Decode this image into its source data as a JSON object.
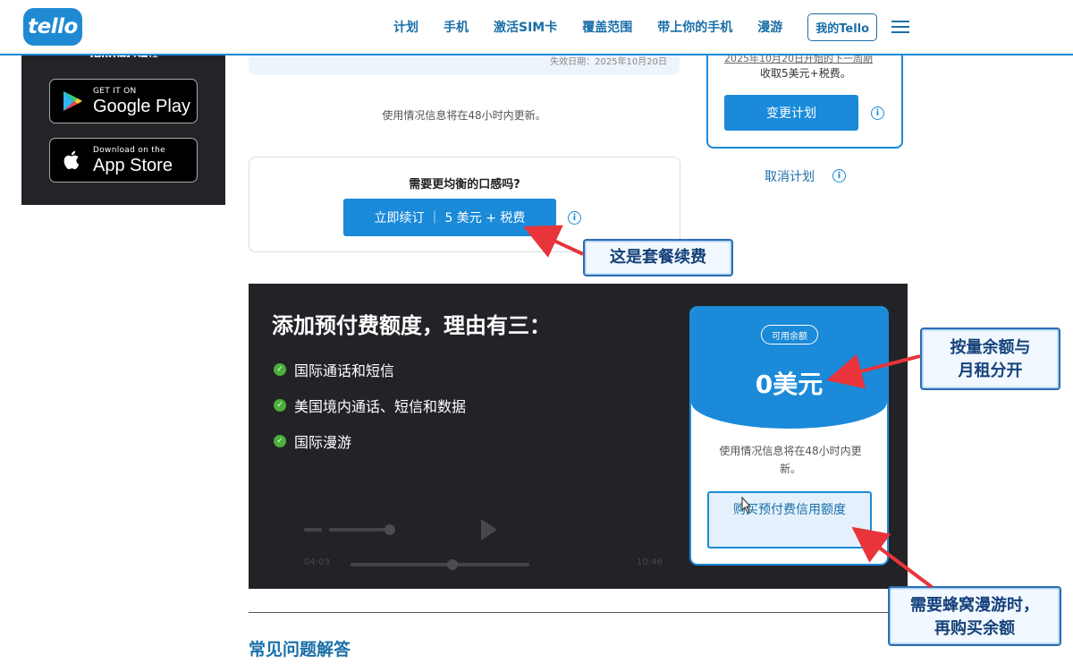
{
  "header": {
    "logo": "tello",
    "nav": [
      "计划",
      "手机",
      "激活SIM卡",
      "覆盖范围",
      "带上你的手机",
      "漫游"
    ],
    "my_tello": "我的Tello",
    "menu_icon": "hamburger-icon"
  },
  "app_panel": {
    "title": "Tello进行通话",
    "google_play": {
      "small": "GET IT ON",
      "big": "Google Play"
    },
    "app_store": {
      "small": "Download on the",
      "big": "App Store"
    }
  },
  "plan_status": {
    "date_text": "失效日期：2025年10月20日",
    "usage_note": "使用情况信息将在48小时内更新。"
  },
  "renew": {
    "question": "需要更均衡的口感吗?",
    "button": "立即续订 ｜ 5 美元 + 税费"
  },
  "plan_box": {
    "date_line": "2025年10月20日开始的下一周期",
    "fee_line": "收取5美元+税费。",
    "change_button": "变更计划",
    "cancel_link": "取消计划"
  },
  "prepaid": {
    "title": "添加预付费额度，理由有三：",
    "reasons": [
      "国际通话和短信",
      "美国境内通话、短信和数据",
      "国际漫游"
    ],
    "video": {
      "time_current": "04:03",
      "time_total": "10:46"
    }
  },
  "balance": {
    "badge": "可用余额",
    "amount": "0美元",
    "note": "使用情况信息将在48小时内更新。",
    "buy_button": "购买预付费信用额度"
  },
  "faq": {
    "title": "常见问题解答"
  },
  "callouts": {
    "renewal_fee": "这是套餐续费",
    "balance_separate": [
      "按量余额与",
      "月租分开"
    ],
    "buy_when_roaming": [
      "需要蜂窝漫游时，",
      "再购买余额"
    ]
  },
  "colors": {
    "brand_blue": "#1a8ad9",
    "dark_bg": "#222327",
    "arrow_red": "#e8343a",
    "callout_border": "#2c6db3"
  }
}
